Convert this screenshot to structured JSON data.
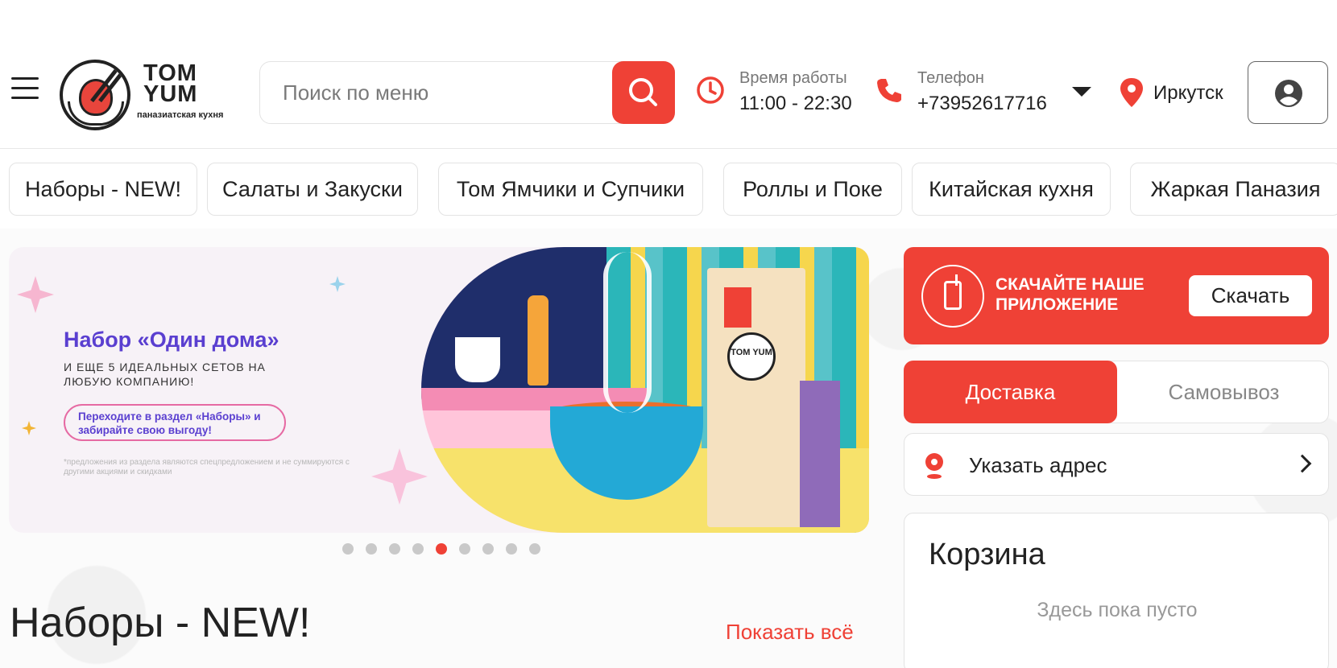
{
  "header": {
    "logo": {
      "brand_line1": "TOM",
      "brand_line2": "YUM",
      "tagline": "паназиатская кухня"
    },
    "search": {
      "placeholder": "Поиск по меню"
    },
    "hours": {
      "label": "Время работы",
      "value": "11:00 - 22:30"
    },
    "phone": {
      "label": "Телефон",
      "value": "+73952617716"
    },
    "city": "Иркутск"
  },
  "categories": [
    "Наборы - NEW!",
    "Салаты и Закуски",
    "Том Ямчики и Супчики",
    "Роллы и Поке",
    "Китайская кухня",
    "Жаркая Паназия"
  ],
  "banner": {
    "title": "Набор «Один дома»",
    "subtitle": "и еще 5 идеальных сетов на любую компанию!",
    "pill": "Переходите в раздел «Наборы» и забирайте свою выгоду!",
    "note": "*предложения из раздела являются спецпредложением и не суммируются с другими акциями и скидками",
    "bag_logo": "TOM YUM",
    "slides_total": 9,
    "active_slide": 5
  },
  "section": {
    "title": "Наборы - NEW!",
    "show_all": "Показать всё"
  },
  "app_promo": {
    "text_line1": "СКАЧАЙТЕ НАШЕ",
    "text_line2": "ПРИЛОЖЕНИЕ",
    "button": "Скачать"
  },
  "delivery_tabs": {
    "active": "Доставка",
    "inactive": "Самовывоз"
  },
  "address": {
    "label": "Указать адрес"
  },
  "cart": {
    "title": "Корзина",
    "empty": "Здесь пока пусто"
  },
  "colors": {
    "accent": "#ef4136",
    "text": "#222222",
    "muted": "#888888"
  }
}
